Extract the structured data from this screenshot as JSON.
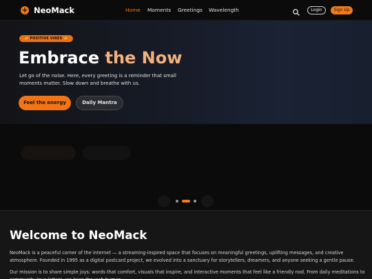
{
  "nav": {
    "brand": "NeoMack",
    "links": [
      "Home",
      "Moments",
      "Greetings",
      "Wavelength"
    ],
    "active": "Home",
    "login_label": "Login",
    "signup_label": "Sign Up"
  },
  "hero": {
    "badge": "✨ POSITIVE VIBES ✨",
    "title_main": "Embrace ",
    "title_accent": "the Now",
    "description": "Let go of the noise. Here, every greeting is a reminder that small moments matter. Slow down and breathe with us.",
    "primary_button": "Feel the energy",
    "secondary_button": "Daily Mantra"
  },
  "carousel": {
    "slide_count": 3,
    "active_index": 1
  },
  "welcome": {
    "title": "Welcome to NeoMack",
    "paragraph1": "NeoMack is a peaceful corner of the internet — a streaming-inspired space that focuses on meaningful greetings, uplifting messages, and creative atmosphere. Founded in 1995 as a digital postcard project, we evolved into a sanctuary for storytellers, dreamers, and anyone seeking a gentle pause.",
    "paragraph2": "Our mission is to share simple joys: words that comfort, visuals that inspire, and interactive moments that feel like a friendly nod. From daily meditations to community love letters, we keep the web human."
  },
  "colors": {
    "accent": "#f47a16",
    "background": "#0e0e0e",
    "hero_accent_text": "#f3b17c"
  }
}
